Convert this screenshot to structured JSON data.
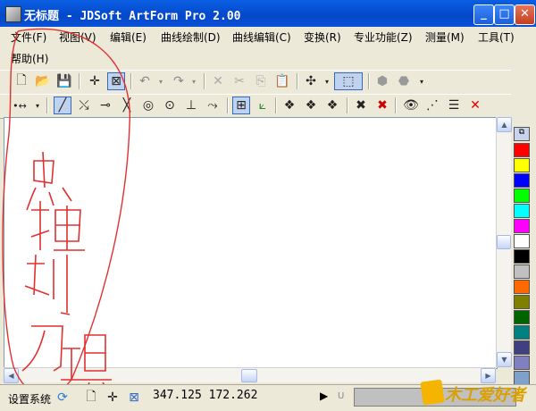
{
  "window": {
    "title": "无标题 - JDSoft ArtForm Pro 2.00",
    "minimize": "_",
    "maximize": "□",
    "close": "✕"
  },
  "menu": [
    {
      "label": "文件(F)"
    },
    {
      "label": "视图(V)"
    },
    {
      "label": "编辑(E)"
    },
    {
      "label": "曲线绘制(D)"
    },
    {
      "label": "曲线编辑(C)"
    },
    {
      "label": "变换(R)"
    },
    {
      "label": "专业功能(Z)"
    },
    {
      "label": "测量(M)"
    },
    {
      "label": "工具(T)"
    },
    {
      "label": "帮助(H)"
    }
  ],
  "status": {
    "system_label": "设置系统",
    "coordinates": "347.125 172.262",
    "play_icon": "▶",
    "u_label": "U"
  },
  "palette": [
    "#ff0000",
    "#ffff00",
    "#0000ff",
    "#00ff00",
    "#00ffff",
    "#ff00ff",
    "#ffffff",
    "#000000",
    "#c0c0c0",
    "#ff6a00",
    "#808000",
    "#006400",
    "#008080",
    "#404080",
    "#8080c0",
    "#7fa0c8"
  ],
  "annotation": {
    "text": "忠建剃刀工具",
    "color": "#e03030"
  },
  "watermark": {
    "text": "木工爱好者"
  }
}
